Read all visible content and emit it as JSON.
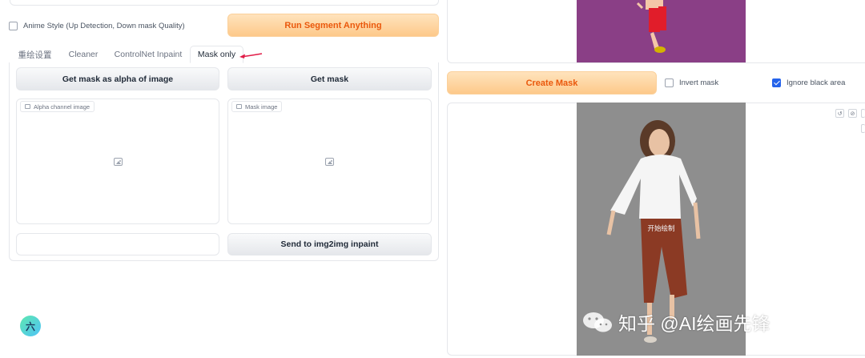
{
  "left": {
    "anime_checkbox_label": "Anime Style (Up Detection, Down mask Quality)",
    "run_button": "Run Segment Anything",
    "tabs": [
      "重绘设置",
      "Cleaner",
      "ControlNet Inpaint",
      "Mask only"
    ],
    "active_tab": "Mask only",
    "get_alpha_button": "Get mask as alpha of image",
    "get_mask_button": "Get mask",
    "alpha_label": "Alpha channel image",
    "mask_label": "Mask image",
    "send_button": "Send to img2img inpaint",
    "fab_label": "六"
  },
  "right": {
    "create_mask_button": "Create Mask",
    "invert_mask_label": "Invert mask",
    "invert_mask_checked": false,
    "ignore_black_label": "Ignore black area",
    "ignore_black_checked": true,
    "paint_hint": "开始绘制",
    "watermark": "知乎 @AI绘画先锋",
    "tool_icons": [
      "undo-icon",
      "clear-icon"
    ]
  },
  "colors": {
    "orange_text": "#ea580c",
    "checkbox_blue": "#2563eb",
    "purple_bg": "#8a3f86",
    "arrow_red": "#e11d48"
  }
}
